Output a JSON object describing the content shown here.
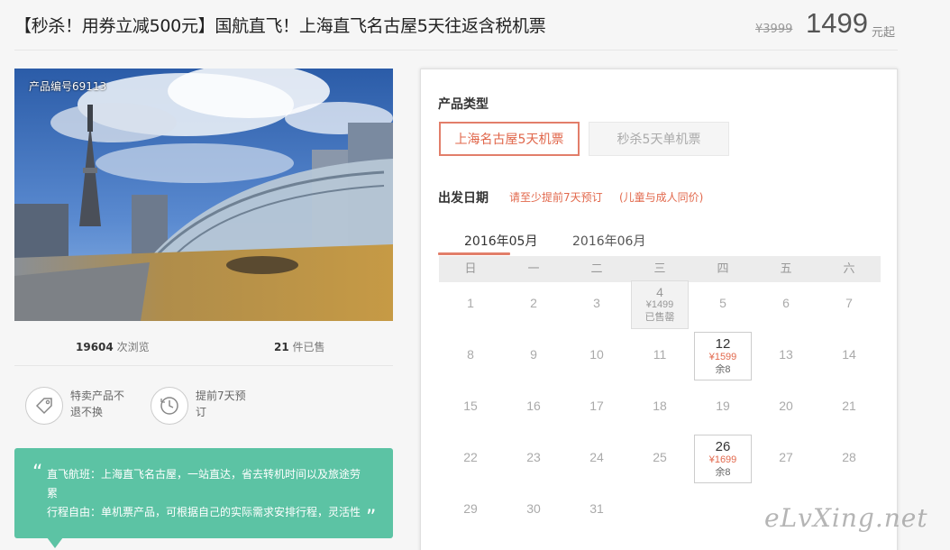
{
  "header": {
    "title": "【秒杀！用券立减500元】国航直飞！上海直飞名古屋5天往返含税机票",
    "price_old": "¥3999",
    "price_now": "1499",
    "price_unit": "元起"
  },
  "gallery": {
    "product_id": "产品编号69113"
  },
  "stats": {
    "views_num": "19604",
    "views_label": " 次浏览",
    "sold_num": "21",
    "sold_label": " 件已售"
  },
  "features": [
    {
      "icon": "tag-icon",
      "text": "特卖产品不退不换"
    },
    {
      "icon": "clock-icon",
      "text": "提前7天预订"
    }
  ],
  "quote": {
    "open": "“",
    "close": "”",
    "line1": "直飞航班：上海直飞名古屋，一站直达，省去转机时间以及旅途劳累",
    "line2": "行程自由：单机票产品，可根据自己的实际需求安排行程，灵活性"
  },
  "panel": {
    "product_type_label": "产品类型",
    "product_types": [
      {
        "label": "上海名古屋5天机票",
        "active": true
      },
      {
        "label": "秒杀5天单机票",
        "active": false
      }
    ],
    "date_label": "出发日期",
    "note1": "请至少提前7天预订",
    "note2": "(儿童与成人同价)",
    "months": [
      {
        "label": "2016年05月",
        "active": true
      },
      {
        "label": "2016年06月",
        "active": false
      }
    ],
    "weekdays": [
      "日",
      "一",
      "二",
      "三",
      "四",
      "五",
      "六"
    ],
    "calendar": [
      [
        "1",
        "2",
        "3",
        "4",
        "5",
        "6",
        "7"
      ],
      [
        "8",
        "9",
        "10",
        "11",
        "12",
        "13",
        "14"
      ],
      [
        "15",
        "16",
        "17",
        "18",
        "19",
        "20",
        "21"
      ],
      [
        "22",
        "23",
        "24",
        "25",
        "26",
        "27",
        "28"
      ],
      [
        "29",
        "30",
        "31",
        "",
        "",
        "",
        ""
      ]
    ],
    "special_days": {
      "4": {
        "status": "sold",
        "price": "¥1499",
        "stock": "已售罄"
      },
      "12": {
        "status": "avail",
        "price": "¥1599",
        "stock": "余8"
      },
      "26": {
        "status": "avail",
        "price": "¥1699",
        "stock": "余8"
      }
    }
  },
  "watermark": "eLvXing.net",
  "colors": {
    "accent": "#e2694d",
    "quote_bg": "#5cc3a4"
  }
}
